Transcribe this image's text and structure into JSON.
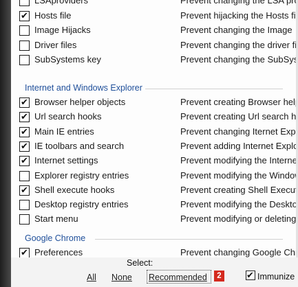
{
  "rows_top": [
    {
      "label": "LSAproviders",
      "desc": "Prevent changing the LSA provi",
      "checked": false
    },
    {
      "label": "Hosts file",
      "desc": "Prevent hijacking the Hosts fil",
      "checked": true
    },
    {
      "label": "Image Hijacks",
      "desc": "Prevent changing the Image",
      "checked": false
    },
    {
      "label": "Driver files",
      "desc": "Prevent changing the driver fil",
      "checked": false
    },
    {
      "label": "SubSystems key",
      "desc": "Prevent changing the SubSyst",
      "checked": false
    }
  ],
  "group_ie": "Internet and Windows Explorer",
  "rows_ie": [
    {
      "label": "Browser helper objects",
      "desc": "Prevent creating Browser help",
      "checked": true
    },
    {
      "label": "Url search hooks",
      "desc": "Prevent creating Url search ho",
      "checked": true
    },
    {
      "label": "Main IE entries",
      "desc": "Prevent changing Iternet Explo",
      "checked": true
    },
    {
      "label": "IE toolbars and search",
      "desc": "Prevent adding Internet Explo",
      "checked": true
    },
    {
      "label": "Internet settings",
      "desc": "Prevent modifying the Internet",
      "checked": true
    },
    {
      "label": "Explorer registry entries",
      "desc": "Prevent modifying the Window",
      "checked": false
    },
    {
      "label": "Shell execute hooks",
      "desc": "Prevent creating Shell Execute",
      "checked": true
    },
    {
      "label": "Desktop registry entries",
      "desc": "Prevent modifying the Deskto",
      "checked": false
    },
    {
      "label": "Start menu",
      "desc": "Prevent modifying or deleting",
      "checked": false
    }
  ],
  "group_chrome": "Google Chrome",
  "rows_chrome": [
    {
      "label": "Preferences",
      "desc": "Prevent changing Google Chro",
      "checked": true
    }
  ],
  "bottom": {
    "select_label": "Select:",
    "all": "All",
    "none": "None",
    "recommended": "Recommended",
    "badge": "2",
    "immunize": "Immunize",
    "immunize_checked": true
  },
  "check_glyph": "✔"
}
